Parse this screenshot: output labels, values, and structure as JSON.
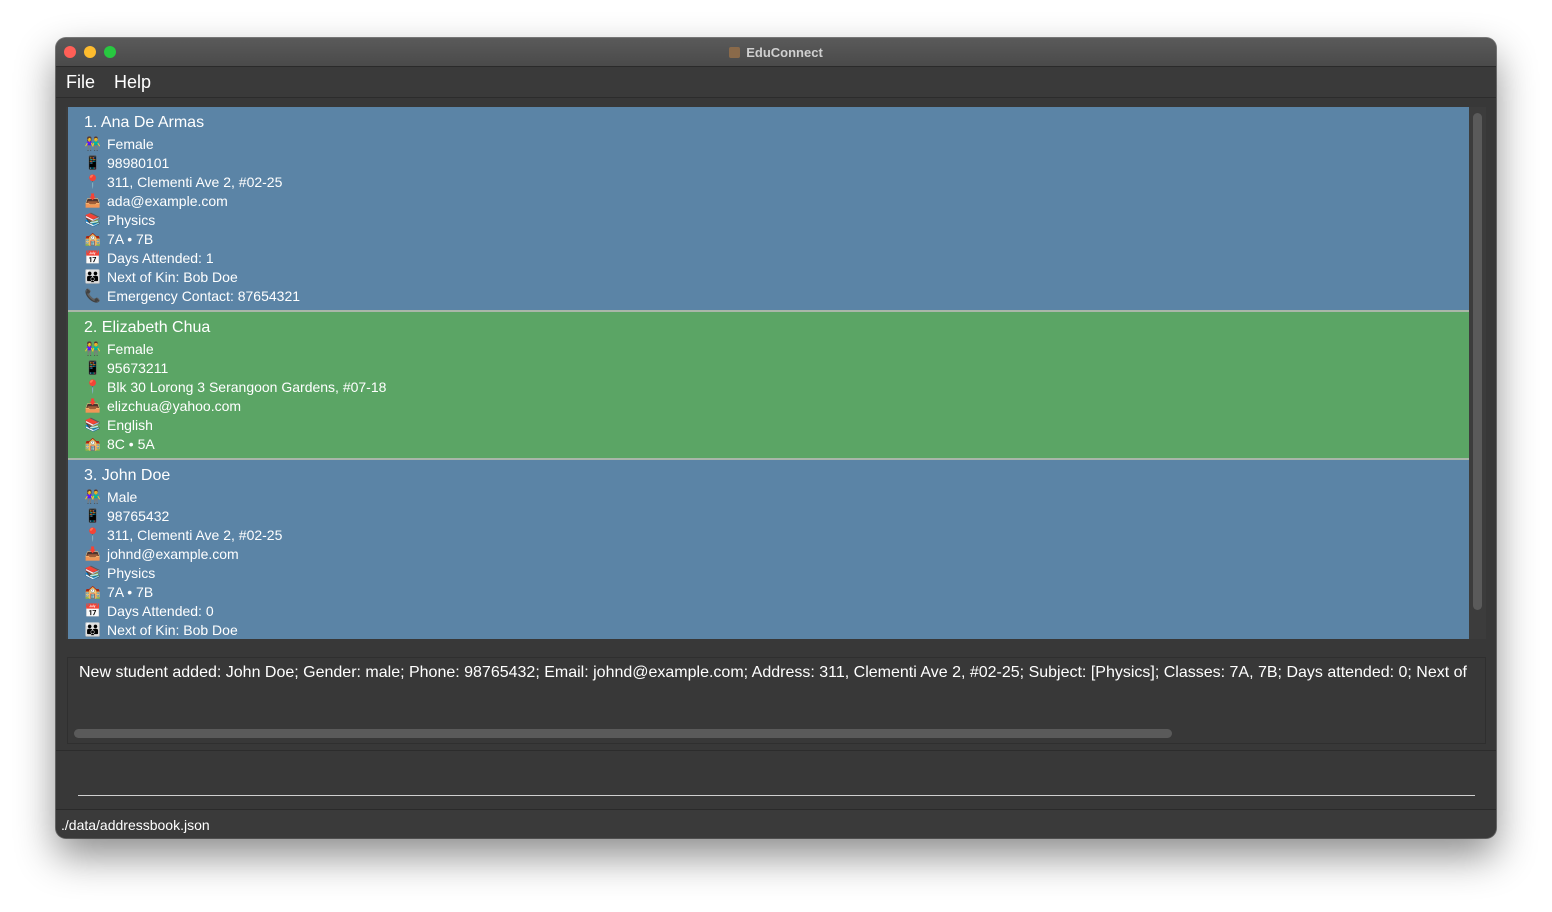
{
  "window": {
    "title": "EduConnect"
  },
  "menu": {
    "items": [
      "File",
      "Help"
    ]
  },
  "students": [
    {
      "index_name": "1. Ana De Armas",
      "gender": "Female",
      "phone": "98980101",
      "address": "311, Clementi Ave 2, #02-25",
      "email": "ada@example.com",
      "subject": "Physics",
      "classes": "7A • 7B",
      "days": "Days Attended: 1",
      "kin": "Next of Kin: Bob Doe",
      "emergency": "Emergency Contact: 87654321"
    },
    {
      "index_name": "2. Elizabeth Chua",
      "gender": "Female",
      "phone": "95673211",
      "address": "Blk 30 Lorong 3 Serangoon Gardens, #07-18",
      "email": "elizchua@yahoo.com",
      "subject": "English",
      "classes": "8C • 5A"
    },
    {
      "index_name": "3. John Doe",
      "gender": "Male",
      "phone": "98765432",
      "address": "311, Clementi Ave 2, #02-25",
      "email": "johnd@example.com",
      "subject": "Physics",
      "classes": "7A • 7B",
      "days": "Days Attended: 0",
      "kin": "Next of Kin: Bob Doe"
    }
  ],
  "result": {
    "message": "New student added: John Doe; Gender: male; Phone: 98765432; Email: johnd@example.com; Address: 311, Clementi Ave 2, #02-25; Subject: [Physics]; Classes: 7A, 7B; Days attended: 0; Next of"
  },
  "command": {
    "value": "",
    "placeholder": ""
  },
  "status": {
    "file_path": "./data/addressbook.json"
  },
  "colors": {
    "card_blue": "#5b84a6",
    "card_green": "#5ba565",
    "background": "#383838"
  },
  "icons": {
    "gender": "people-icon",
    "phone": "mobile-phone-icon",
    "address": "pin-icon",
    "email": "email-tray-icon",
    "subject": "books-icon",
    "classes": "school-icon",
    "days": "calendar-icon",
    "kin": "family-icon",
    "emergency": "telephone-icon"
  }
}
